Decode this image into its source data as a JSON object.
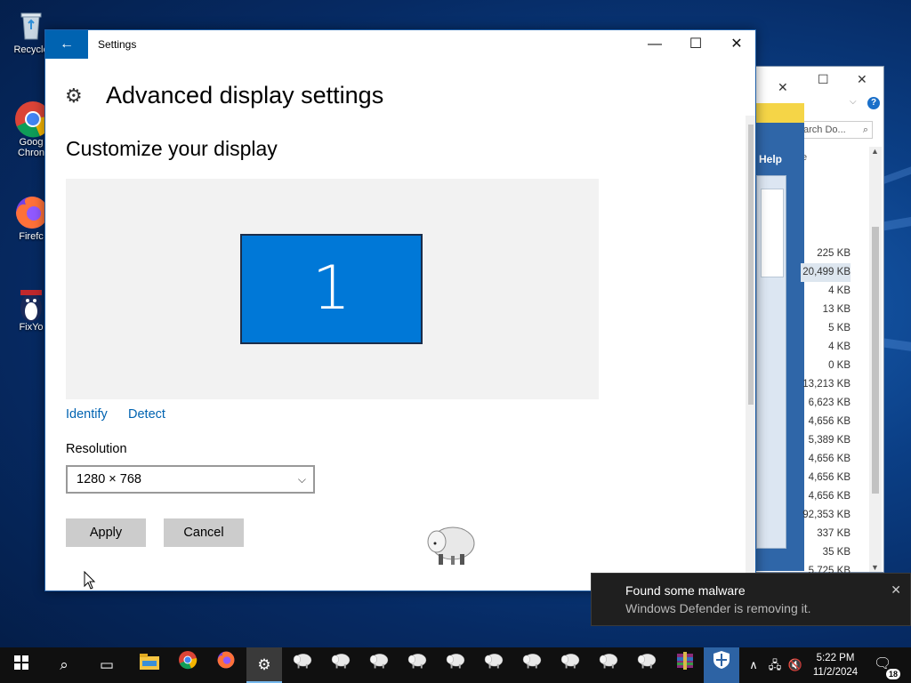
{
  "desktop": {
    "icons": [
      {
        "label": "Recycle",
        "icon": "recycle-bin-icon"
      },
      {
        "label": "Goog Chron",
        "icon": "chrome-icon"
      },
      {
        "label": "Firefc",
        "icon": "firefox-icon"
      },
      {
        "label": "FixYo",
        "icon": "fixyo-app-icon"
      }
    ]
  },
  "background_window": {
    "search_placeholder": "arch Do...",
    "help_label": "Help",
    "partial_header": "e",
    "file_sizes": [
      "225 KB",
      "20,499 KB",
      "4 KB",
      "13 KB",
      "5 KB",
      "4 KB",
      "0 KB",
      "13,213 KB",
      "6,623 KB",
      "4,656 KB",
      "5,389 KB",
      "4,656 KB",
      "4,656 KB",
      "4,656 KB",
      "92,353 KB",
      "337 KB",
      "35 KB",
      "5,725 KB"
    ],
    "selected_row_index": 1
  },
  "settings": {
    "window_title": "Settings",
    "page_title": "Advanced display settings",
    "section_title": "Customize your display",
    "monitor_number": "1",
    "identify_label": "Identify",
    "detect_label": "Detect",
    "resolution_label": "Resolution",
    "resolution_value": "1280 × 768",
    "apply_label": "Apply",
    "cancel_label": "Cancel"
  },
  "toast": {
    "title": "Found some malware",
    "message": "Windows Defender is removing it."
  },
  "taskbar": {
    "time": "5:22 PM",
    "date": "11/2/2024",
    "notification_count": "18",
    "apps": [
      "start",
      "search",
      "task-view",
      "file-explorer",
      "chrome",
      "firefox",
      "settings",
      "sheep",
      "sheep",
      "sheep",
      "sheep",
      "sheep",
      "sheep",
      "sheep",
      "sheep",
      "sheep",
      "sheep",
      "winrar",
      "windows-defender"
    ]
  },
  "colors": {
    "accent": "#0063b1",
    "monitor_fill": "#0078d7",
    "toast_bg": "#1f1f1f",
    "taskbar_bg": "#101010"
  }
}
